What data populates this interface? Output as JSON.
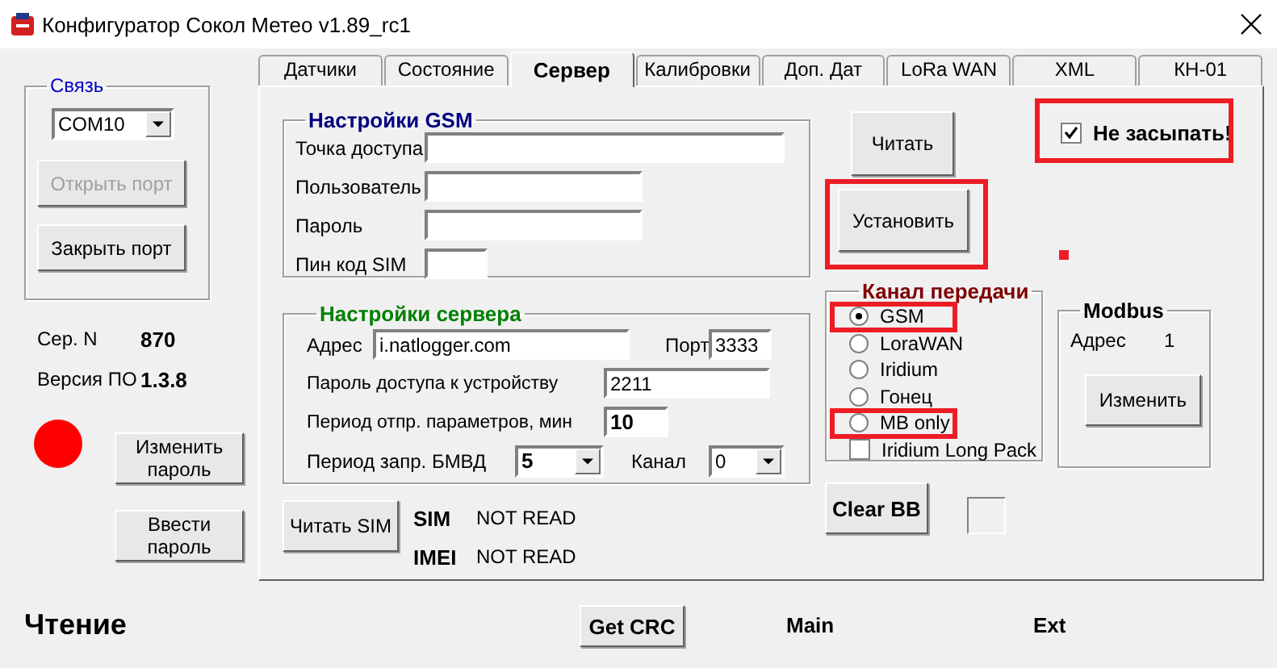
{
  "window": {
    "title": "Конфигуратор Сокол Метео v1.89_rc1"
  },
  "connection": {
    "title": "Связь",
    "port": "COM10",
    "buttons": [
      {
        "label": "Открыть порт",
        "disabled": true
      },
      {
        "label": "Закрыть порт",
        "disabled": false
      }
    ]
  },
  "device": {
    "serial_label": "Сер. N",
    "serial": "870",
    "version_label": "Версия ПО",
    "version": "1.3.8",
    "buttons": [
      "Изменить пароль",
      "Ввести пароль"
    ]
  },
  "status": "Чтение",
  "tabs": [
    {
      "label": "Датчики",
      "selected": false
    },
    {
      "label": "Состояние",
      "selected": false
    },
    {
      "label": "Сервер",
      "selected": true
    },
    {
      "label": "Калибровки",
      "selected": false
    },
    {
      "label": "Доп. Дат",
      "selected": false
    },
    {
      "label": "LoRa WAN",
      "selected": false
    },
    {
      "label": "XML",
      "selected": false
    },
    {
      "label": "КН-01",
      "selected": false
    }
  ],
  "gsm": {
    "title": "Настройки GSM",
    "fields": [
      {
        "label": "Точка доступа"
      },
      {
        "label": "Пользователь"
      },
      {
        "label": "Пароль"
      },
      {
        "label": "Пин код SIM"
      }
    ]
  },
  "server": {
    "title": "Настройки сервера",
    "address_label": "Адрес",
    "address": "i.natlogger.com",
    "port_label": "Порт",
    "port": "3333",
    "password_label": "Пароль доступа к устройству",
    "password": "2211",
    "period_label": "Период отпр. параметров, мин",
    "period": "10",
    "bmvd_label": "Период запр.  БМВД",
    "bmvd": "5",
    "channel_label": "Канал",
    "channel": "0"
  },
  "sim": {
    "button": "Читать SIM",
    "rows": [
      {
        "label": "SIM",
        "value": "NOT READ"
      },
      {
        "label": "IMEI",
        "value": "NOT READ"
      }
    ]
  },
  "read_button": "Читать",
  "set_button": {
    "label": "Установить",
    "highlighted": true
  },
  "no_sleep": {
    "label": "Не засыпать!",
    "checked": true,
    "highlighted": true
  },
  "transmission": {
    "title": "Канал передачи",
    "options": [
      {
        "kind": "radio",
        "label": "GSM",
        "selected": true,
        "highlighted": true
      },
      {
        "kind": "radio",
        "label": "LoraWAN",
        "selected": false,
        "highlighted": false
      },
      {
        "kind": "radio",
        "label": "Iridium",
        "selected": false,
        "highlighted": false
      },
      {
        "kind": "radio",
        "label": "Гонец",
        "selected": false,
        "highlighted": false
      },
      {
        "kind": "radio",
        "label": "MB only",
        "selected": false,
        "highlighted": true
      },
      {
        "kind": "checkbox",
        "label": "Iridium Long Pack",
        "checked": false,
        "highlighted": false
      }
    ]
  },
  "modbus": {
    "title": "Modbus",
    "address_label": "Адрес",
    "address": "1",
    "button": "Изменить"
  },
  "clear_button": "Clear BB",
  "footer": {
    "crc_button": "Get CRC",
    "main": "Main",
    "ext": "Ext"
  }
}
